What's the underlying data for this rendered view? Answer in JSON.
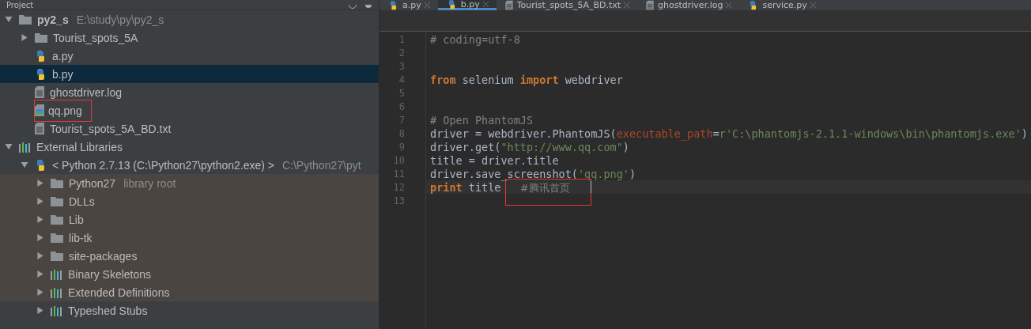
{
  "project_panel": {
    "title": "Project",
    "tree": [
      {
        "name": "py2_s",
        "detail": "E:\\study\\py\\py2_s",
        "kind": "folder",
        "bold": true,
        "expanded": true,
        "selected": false,
        "annotated": false,
        "library_scope": false,
        "children": [
          {
            "name": "Tourist_spots_5A",
            "kind": "folder",
            "bold": false,
            "expanded": false,
            "selected": false,
            "annotated": false,
            "library_scope": false
          },
          {
            "name": "a.py",
            "kind": "python",
            "bold": false,
            "selected": false,
            "annotated": false,
            "library_scope": false
          },
          {
            "name": "b.py",
            "kind": "python",
            "bold": false,
            "selected": true,
            "annotated": false,
            "library_scope": false
          },
          {
            "name": "ghostdriver.log",
            "kind": "text",
            "bold": false,
            "selected": false,
            "annotated": false,
            "library_scope": false
          },
          {
            "name": "qq.png",
            "kind": "image",
            "bold": false,
            "selected": false,
            "annotated": true,
            "library_scope": false
          },
          {
            "name": "Tourist_spots_5A_BD.txt",
            "kind": "text",
            "bold": false,
            "selected": false,
            "annotated": false,
            "library_scope": false
          }
        ]
      },
      {
        "name": "External Libraries",
        "kind": "library",
        "bold": false,
        "expanded": true,
        "selected": false,
        "annotated": false,
        "library_scope": false,
        "children": [
          {
            "name": "< Python 2.7.13 (C:\\Python27\\python2.exe) >",
            "detail": "C:\\Python27\\pyt",
            "kind": "python",
            "bold": false,
            "expanded": true,
            "selected": false,
            "annotated": false,
            "library_scope": false,
            "children": [
              {
                "name": "Python27",
                "detail": "library root",
                "kind": "folder",
                "bold": false,
                "expanded": false,
                "selected": false,
                "annotated": false,
                "library_scope": true
              },
              {
                "name": "DLLs",
                "kind": "folder",
                "bold": false,
                "expanded": false,
                "selected": false,
                "annotated": false,
                "library_scope": true
              },
              {
                "name": "Lib",
                "kind": "folder",
                "bold": false,
                "expanded": false,
                "selected": false,
                "annotated": false,
                "library_scope": true
              },
              {
                "name": "lib-tk",
                "kind": "folder",
                "bold": false,
                "expanded": false,
                "selected": false,
                "annotated": false,
                "library_scope": true
              },
              {
                "name": "site-packages",
                "kind": "folder",
                "bold": false,
                "expanded": false,
                "selected": false,
                "annotated": false,
                "library_scope": true
              },
              {
                "name": "Binary Skeletons",
                "kind": "library",
                "bold": false,
                "expanded": false,
                "selected": false,
                "annotated": false,
                "library_scope": true
              },
              {
                "name": "Extended Definitions",
                "kind": "library",
                "bold": false,
                "expanded": false,
                "selected": false,
                "annotated": false,
                "library_scope": true
              },
              {
                "name": "Typeshed Stubs",
                "kind": "library",
                "bold": false,
                "expanded": false,
                "selected": false,
                "annotated": false,
                "library_scope": false
              }
            ]
          }
        ]
      }
    ]
  },
  "editor": {
    "tabs": [
      {
        "label": "a.py",
        "kind": "python",
        "selected": false
      },
      {
        "label": "b.py",
        "kind": "python",
        "selected": true
      },
      {
        "label": "Tourist_spots_5A_BD.txt",
        "kind": "text",
        "selected": false
      },
      {
        "label": "ghostdriver.log",
        "kind": "text",
        "selected": false
      },
      {
        "label": "service.py",
        "kind": "python",
        "selected": false
      }
    ],
    "lines": [
      {
        "number": "1",
        "current": false,
        "tokens": [
          {
            "kind": "comment",
            "text": "# coding=utf-8"
          }
        ]
      },
      {
        "number": "2",
        "current": false
      },
      {
        "number": "3",
        "current": false
      },
      {
        "number": "4",
        "current": false,
        "tokens": [
          {
            "kind": "keyword",
            "text": "from"
          },
          {
            "kind": "plain",
            "text": " selenium "
          },
          {
            "kind": "keyword",
            "text": "import"
          },
          {
            "kind": "plain",
            "text": " webdriver"
          }
        ]
      },
      {
        "number": "5",
        "current": false
      },
      {
        "number": "6",
        "current": false
      },
      {
        "number": "7",
        "current": false,
        "tokens": [
          {
            "kind": "comment",
            "text": "# Open PhantomJS"
          }
        ]
      },
      {
        "number": "8",
        "current": false,
        "tokens": [
          {
            "kind": "plain",
            "text": "driver = webdriver.PhantomJS("
          },
          {
            "kind": "param",
            "text": "executable_path"
          },
          {
            "kind": "plain",
            "text": "="
          },
          {
            "kind": "string",
            "text": "r'C:\\phantomjs-2.1.1-windows\\bin\\phantomjs.exe'"
          },
          {
            "kind": "plain",
            "text": ")"
          }
        ]
      },
      {
        "number": "9",
        "current": false,
        "tokens": [
          {
            "kind": "plain",
            "text": "driver.get("
          },
          {
            "kind": "string",
            "text": "\"http://www.qq.com\""
          },
          {
            "kind": "plain",
            "text": ")"
          }
        ]
      },
      {
        "number": "10",
        "current": false,
        "tokens": [
          {
            "kind": "plain",
            "text": "title = driver.title"
          }
        ]
      },
      {
        "number": "11",
        "current": false,
        "tokens": [
          {
            "kind": "plain",
            "text": "driver.save_screenshot("
          },
          {
            "kind": "string",
            "text": "'qq.png'"
          },
          {
            "kind": "plain",
            "text": ")"
          }
        ]
      },
      {
        "number": "12",
        "current": true,
        "tokens": [
          {
            "kind": "keyword",
            "text": "print"
          },
          {
            "kind": "plain",
            "text": " title   "
          },
          {
            "kind": "comment",
            "text": "#腾讯首页",
            "annotated": true
          }
        ]
      },
      {
        "number": "13",
        "current": false
      }
    ]
  }
}
